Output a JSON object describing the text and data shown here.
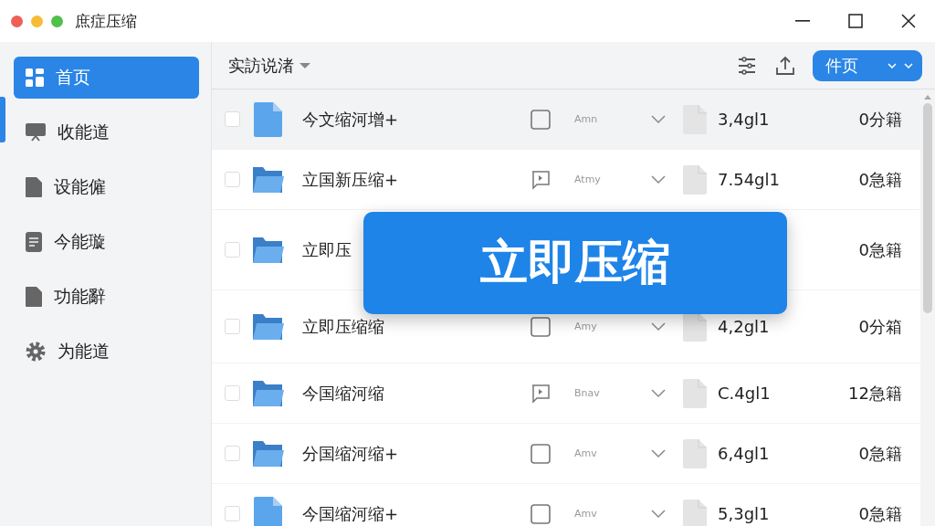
{
  "window": {
    "title": "庶症压缩"
  },
  "sidebar": {
    "items": [
      {
        "label": "首页",
        "kind": "grid",
        "selected": true
      },
      {
        "label": "收能道",
        "kind": "monitor",
        "selected": false
      },
      {
        "label": "设能僱",
        "kind": "doc",
        "selected": false
      },
      {
        "label": "今能璇",
        "kind": "lines",
        "selected": false
      },
      {
        "label": "功能辭",
        "kind": "doc",
        "selected": false
      },
      {
        "label": "为能道",
        "kind": "gear",
        "selected": false
      }
    ]
  },
  "toolbar": {
    "dropdown": "实訪说渚",
    "button": "件页"
  },
  "rows": [
    {
      "kind": "doc",
      "name": "今文缩河增+",
      "status": {
        "kind": "square"
      },
      "tag": "Amn",
      "size": "3,4gl1",
      "count": "0分籍",
      "selected": true,
      "checked": false
    },
    {
      "kind": "folder",
      "name": "立国新压缩+",
      "status": {
        "kind": "chat"
      },
      "tag": "Atmy",
      "size": "7.54gl1",
      "count": "0急籍",
      "selected": false,
      "checked": false
    },
    {
      "kind": "folder",
      "name": "立即压",
      "count": "0急籍",
      "selected": false,
      "checked": false
    },
    {
      "kind": "folder",
      "name": "立即压缩缩",
      "status": {
        "kind": "square"
      },
      "tag": "Amy",
      "size": "4,2gl1",
      "count": "0分箱",
      "selected": false,
      "checked": false
    },
    {
      "kind": "folder",
      "name": "今国缩河缩",
      "status": {
        "kind": "chat"
      },
      "tag": "Bnav",
      "size": "C.4gl1",
      "count": "12急籍",
      "selected": false,
      "checked": false
    },
    {
      "kind": "folder",
      "name": "分国缩河缩+",
      "status": {
        "kind": "square"
      },
      "tag": "Amv",
      "size": "6,4gl1",
      "count": "0急籍",
      "selected": false,
      "checked": false
    },
    {
      "kind": "doc",
      "name": "今国缩河缩+",
      "status": {
        "kind": "square"
      },
      "tag": "Amv",
      "size": "5,3gl1",
      "count": "0急籍",
      "selected": false,
      "checked": false
    }
  ],
  "overlay_button": "立即压缩"
}
